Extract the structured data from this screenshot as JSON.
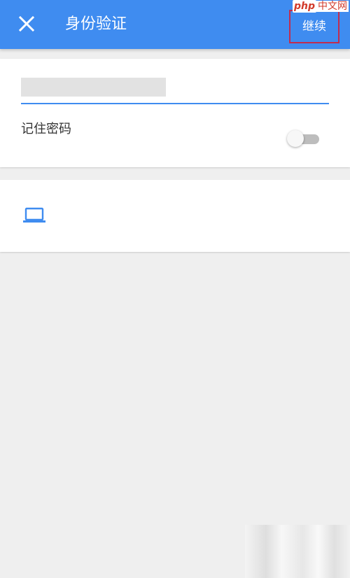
{
  "appbar": {
    "title": "身份验证",
    "continue_label": "继续",
    "close_icon": "close-icon"
  },
  "watermark": {
    "php": "php",
    "site": "中文网"
  },
  "form": {
    "password_value_redacted": true,
    "remember_label": "记住密码",
    "remember_on": false
  },
  "devices": {
    "icon": "laptop-icon"
  },
  "colors": {
    "primary": "#3f8cf0",
    "highlight_border": "#c22c4e",
    "background": "#efefef"
  }
}
